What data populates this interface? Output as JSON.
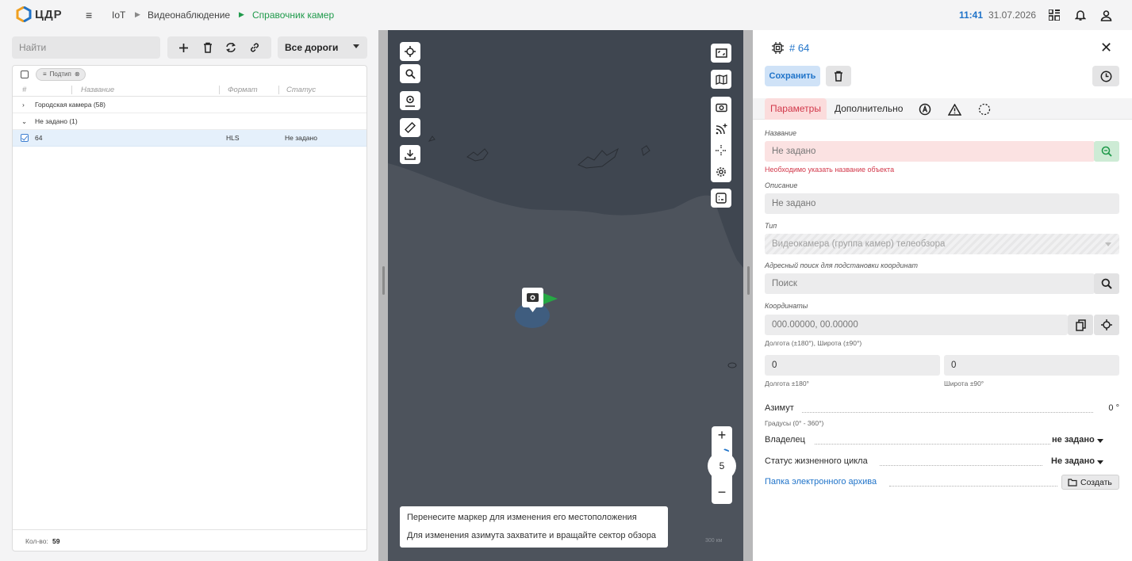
{
  "topbar": {
    "logo_text": "ЦДР",
    "breadcrumbs": [
      "IoT",
      "Видеонаблюдение",
      "Справочник камер"
    ],
    "time": "11:41",
    "date": "31.07.2026"
  },
  "left": {
    "search_placeholder": "Найти",
    "roads_select": "Все дороги",
    "filter_chip": "Подтип",
    "columns": [
      "#",
      "Название",
      "Формат",
      "Статус"
    ],
    "groups": [
      {
        "label": "Городская камера (58)",
        "expanded": false
      },
      {
        "label": "Не задано (1)",
        "expanded": true
      }
    ],
    "row": {
      "id": "64",
      "format": "HLS",
      "status": "Не задано"
    },
    "footer_label": "Кол-во:",
    "footer_count": "59"
  },
  "map": {
    "zoom": "5",
    "hint_line1": "Перенесите маркер для изменения его местоположения",
    "hint_line2": "Для изменения азимута захватите и вращайте сектор обзора",
    "scale": "300 км",
    "marker_color": "#26a844"
  },
  "right": {
    "title": "# 64",
    "save_label": "Сохранить",
    "tabs": [
      "Параметры",
      "Дополнительно"
    ],
    "name_label": "Название",
    "name_placeholder": "Не задано",
    "name_error": "Необходимо указать название объекта",
    "desc_label": "Описание",
    "desc_placeholder": "Не задано",
    "type_label": "Тип",
    "type_value": "Видеокамера (группа камер) телеобзора",
    "addr_label": "Адресный поиск для подстановки координат",
    "addr_placeholder": "Поиск",
    "coords_label": "Координаты",
    "coords_value": "000.00000, 00.00000",
    "coords_hint": "Долгота (±180°), Широта (±90°)",
    "lon_value": "0",
    "lat_value": "0",
    "lon_hint": "Долгота ±180°",
    "lat_hint": "Широта ±90°",
    "azimuth_label": "Азимут",
    "azimuth_value": "0 °",
    "azimuth_hint": "Градусы (0° - 360°)",
    "owner_label": "Владелец",
    "owner_value": "не задано",
    "lifecycle_label": "Статус жизненного цикла",
    "lifecycle_value": "Не задано",
    "archive_label": "Папка электронного архива",
    "create_label": "Создать"
  },
  "colors": {
    "accent_blue": "#1f73c9",
    "accent_green": "#1f9a4b",
    "error_red": "#d2384a"
  }
}
